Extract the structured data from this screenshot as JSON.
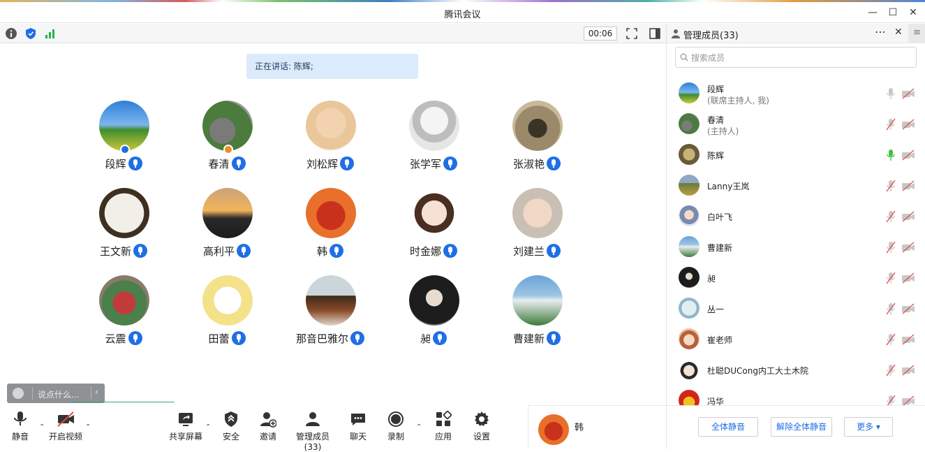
{
  "window": {
    "title": "腾讯会议",
    "timer": "00:06"
  },
  "stage": {
    "speaking": "正在讲话: 陈辉;",
    "tiles": [
      {
        "name": "段辉",
        "avatar": "sky-field",
        "badge": "blue"
      },
      {
        "name": "春清",
        "avatar": "racetrack",
        "badge": "orange"
      },
      {
        "name": "刘松辉",
        "avatar": "anime-girls"
      },
      {
        "name": "张学军",
        "avatar": "sketch-girl"
      },
      {
        "name": "张淑艳",
        "avatar": "room-portrait"
      },
      {
        "name": "王文新",
        "avatar": "dumplings"
      },
      {
        "name": "高利平",
        "avatar": "sunset-lake"
      },
      {
        "name": "韩",
        "avatar": "red-monkey"
      },
      {
        "name": "时金娜",
        "avatar": "cartoon-girl"
      },
      {
        "name": "刘建兰",
        "avatar": "child-face"
      },
      {
        "name": "云震",
        "avatar": "masks"
      },
      {
        "name": "田蕾",
        "avatar": "duck-cartoon"
      },
      {
        "name": "那音巴雅尔",
        "avatar": "food-table"
      },
      {
        "name": "昶",
        "avatar": "dark-portrait"
      },
      {
        "name": "曹建新",
        "avatar": "white-sculpture"
      }
    ]
  },
  "chat": {
    "placeholder": "说点什么..."
  },
  "bottombar": {
    "mute": "静音",
    "video": "开启视频",
    "share": "共享屏幕",
    "security": "安全",
    "invite": "邀请",
    "members": "管理成员(33)",
    "chat": "聊天",
    "record": "录制",
    "apps": "应用",
    "settings": "设置"
  },
  "speaker": {
    "name": "韩"
  },
  "panel": {
    "title": "管理成员(33)",
    "search_placeholder": "搜索成员",
    "members": [
      {
        "name": "段辉",
        "sub": "(联席主持人, 我)",
        "avatar": "sky-field",
        "mic": "gray"
      },
      {
        "name": "春清",
        "sub": "(主持人)",
        "avatar": "racetrack",
        "mic": "muted"
      },
      {
        "name": "陈辉",
        "sub": "",
        "avatar": "portrait-old",
        "mic": "active"
      },
      {
        "name": "Lanny王岚",
        "sub": "",
        "avatar": "field-house",
        "mic": "muted"
      },
      {
        "name": "白叶飞",
        "sub": "",
        "avatar": "girl-photo",
        "mic": "muted"
      },
      {
        "name": "曹建新",
        "sub": "",
        "avatar": "white-sculpture",
        "mic": "muted"
      },
      {
        "name": "昶",
        "sub": "",
        "avatar": "dark-portrait",
        "mic": "muted"
      },
      {
        "name": "丛一",
        "sub": "",
        "avatar": "winter-scene",
        "mic": "muted"
      },
      {
        "name": "崔老师",
        "sub": "",
        "avatar": "cartoon-woman",
        "mic": "muted"
      },
      {
        "name": "杜聪DUCong内工大土木院",
        "sub": "",
        "avatar": "cartoon-man",
        "mic": "muted"
      },
      {
        "name": "冯华",
        "sub": "",
        "avatar": "red-yellow",
        "mic": "muted"
      }
    ],
    "mute_all": "全体静音",
    "unmute_all": "解除全体静音",
    "more": "更多 ▾"
  },
  "colors": {
    "accent": "#1f6fe5",
    "speaking_bg": "#dcebfb",
    "mic_active": "#3ec23e",
    "muted_red": "#e24a4a"
  }
}
